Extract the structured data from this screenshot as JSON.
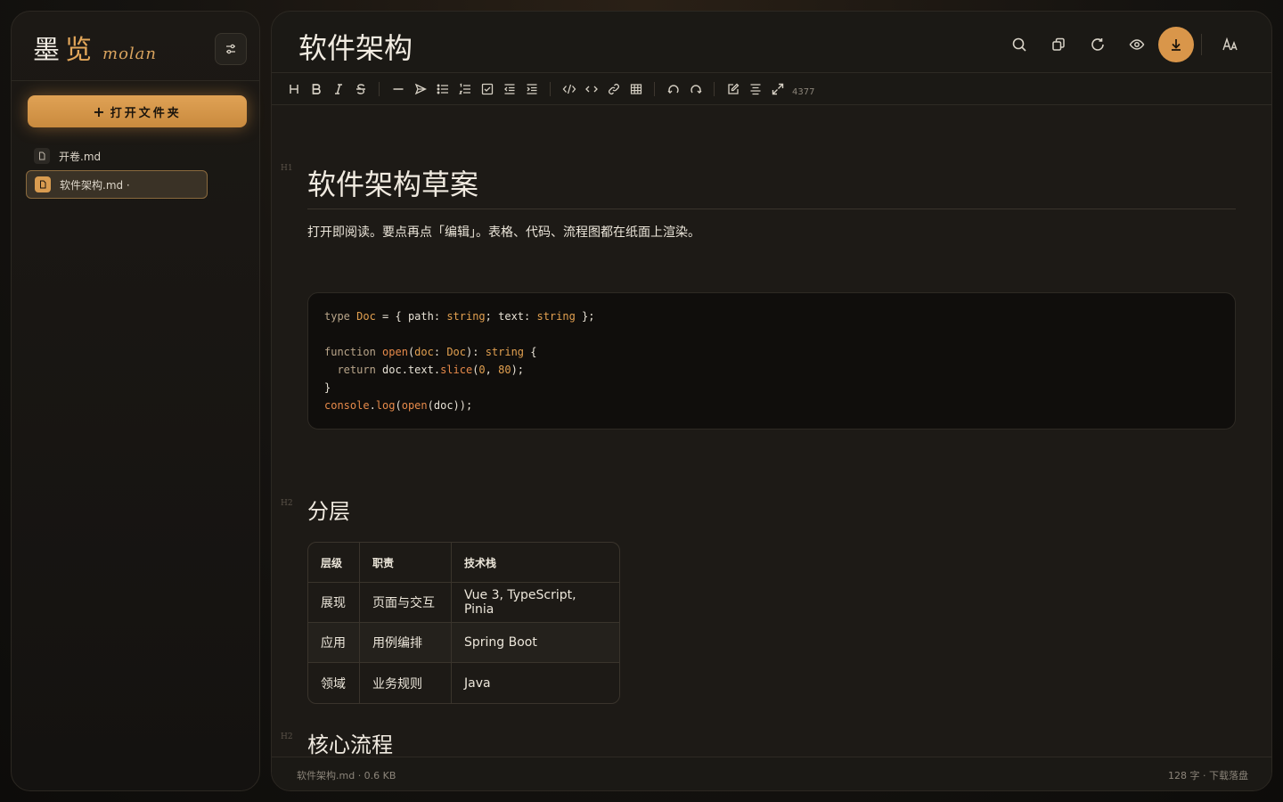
{
  "app": {
    "brand_cn_1": "墨",
    "brand_cn_2": "览",
    "brand_en": "molan"
  },
  "sidebar": {
    "open_folder_label": "打开文件夹",
    "files": [
      {
        "name": "开卷.md",
        "active": false
      },
      {
        "name": "软件架构.md ·",
        "active": true
      }
    ]
  },
  "header": {
    "title": "软件架构",
    "actions": [
      "search-icon",
      "copy-icon",
      "refresh-icon",
      "eye-icon",
      "download-icon",
      "font-size-icon"
    ]
  },
  "toolbar": {
    "count": "4377"
  },
  "document": {
    "h1_marker": "H1",
    "h1": "软件架构草案",
    "paragraph": "打开即阅读。要点再点「编辑」。表格、代码、流程图都在纸面上渲染。",
    "h2_marker": "H2",
    "h2_layers": "分层",
    "table": {
      "headers": [
        "层级",
        "职责",
        "技术栈"
      ],
      "rows": [
        [
          "展现",
          "页面与交互",
          "Vue 3, TypeScript, Pinia"
        ],
        [
          "应用",
          "用例编排",
          "Spring Boot"
        ],
        [
          "领域",
          "业务规则",
          "Java"
        ]
      ]
    },
    "h2_flow": "核心流程"
  },
  "status": {
    "left": "软件架构.md · 0.6 KB",
    "right": "128 字 · 下载落盘"
  },
  "colors": {
    "accent": "#d9964a",
    "background": "#1b1915"
  }
}
